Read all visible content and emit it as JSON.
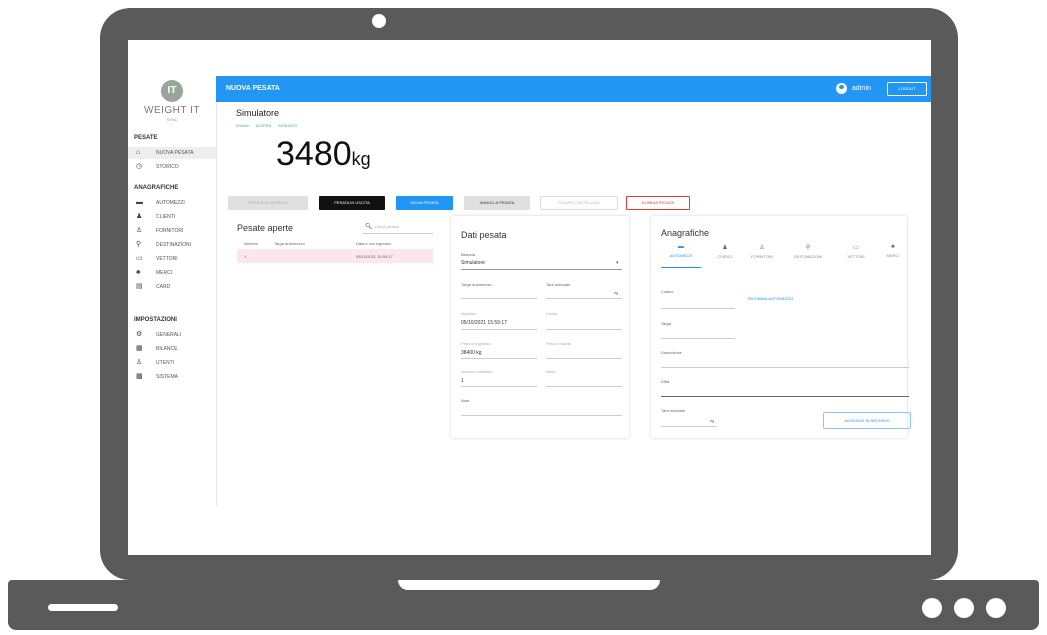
{
  "topbar": {
    "title": "NUOVA PESATA",
    "user": "admin",
    "logout": "LOGOUT"
  },
  "brand": {
    "logo_mark": "IT",
    "logo_text": "WEIGHT IT",
    "logo_sub": "SYNC"
  },
  "sidebar": {
    "sections": [
      {
        "title": "PESATE",
        "items": [
          {
            "label": "NUOVA PESATA",
            "icon": "home-icon",
            "glyph": "⌂",
            "active": true
          },
          {
            "label": "STORICO",
            "icon": "history-icon",
            "glyph": "◷"
          }
        ]
      },
      {
        "title": "ANAGRAFICHE",
        "items": [
          {
            "label": "AUTOMEZZI",
            "icon": "truck-icon",
            "glyph": "▬"
          },
          {
            "label": "CLIENTI",
            "icon": "person-icon",
            "glyph": "♟"
          },
          {
            "label": "FORNITORI",
            "icon": "supplier-icon",
            "glyph": "♙"
          },
          {
            "label": "DESTINAZIONI",
            "icon": "location-pin-icon",
            "glyph": "⚲"
          },
          {
            "label": "VETTORI",
            "icon": "carrier-icon",
            "glyph": "▭"
          },
          {
            "label": "MERCI",
            "icon": "goods-icon",
            "glyph": "♣"
          },
          {
            "label": "CARD",
            "icon": "card-icon",
            "glyph": "▤"
          }
        ]
      },
      {
        "title": "IMPOSTAZIONI",
        "items": [
          {
            "label": "GENERALI",
            "icon": "gear-icon",
            "glyph": "⚙"
          },
          {
            "label": "BILANCE",
            "icon": "scale-icon",
            "glyph": "▦"
          },
          {
            "label": "UTENTI",
            "icon": "users-icon",
            "glyph": "♙"
          },
          {
            "label": "SISTEMA",
            "icon": "system-icon",
            "glyph": "▩"
          }
        ]
      }
    ]
  },
  "scale": {
    "name": "Simulatore",
    "links": [
      "Priorità",
      "AZZERA",
      "ASSUNTO"
    ],
    "weight": "3480",
    "unit": "kg"
  },
  "actions": {
    "weigh_in": "PESATA IN ENTRATA",
    "weigh_out": "PESATA IN USCITA",
    "save": "SALVA PESATA",
    "cancel": "ANNULLA PESATA",
    "print": "STAMPA CARTELLINO",
    "delete": "ELIMINA PESATA"
  },
  "open_weighings": {
    "title": "Pesate aperte",
    "search_placeholder": "Cerca pesata",
    "columns": [
      "Numero",
      "Targa automezzo",
      "Data e ora ingresso"
    ],
    "rows": [
      {
        "numero": "1",
        "targa": "",
        "data": "05/10/2021 15:59:17"
      }
    ]
  },
  "details": {
    "title": "Dati pesata",
    "scale_label": "Bilancia",
    "scale_value": "Simulatore",
    "plate_label": "Targa automezzo",
    "tare_label": "Tara manuale",
    "tare_unit": "kg",
    "entry_label": "Ingresso",
    "entry_value": "05/10/2021 15:59:17",
    "exit_label": "Uscita",
    "weight_in_label": "Peso in ingresso",
    "weight_in_value": "38400 kg",
    "weight_out_label": "Peso in uscita",
    "card_label": "Numero cartellino",
    "card_value": "1",
    "net_label": "Netto",
    "notes_label": "Note"
  },
  "registry": {
    "title": "Anagrafiche",
    "tabs": [
      {
        "label": "AUTOMEZZI",
        "icon": "truck-icon",
        "glyph": "▬",
        "active": true
      },
      {
        "label": "CLIENTI",
        "icon": "person-icon",
        "glyph": "♟"
      },
      {
        "label": "FORNITORI",
        "icon": "supplier-icon",
        "glyph": "♙"
      },
      {
        "label": "DESTINAZIONI",
        "icon": "location-pin-icon",
        "glyph": "⚲"
      },
      {
        "label": "VETTORI",
        "icon": "carrier-icon",
        "glyph": "▭"
      },
      {
        "label": "MERCI",
        "icon": "goods-icon",
        "glyph": "♣"
      }
    ],
    "code_label": "Codice",
    "recall_button": "RICHIAMA AUTOMEZZO",
    "plate_label": "Targa",
    "description_label": "Descrizione",
    "company_label": "Ditta",
    "tare_label": "Tara manuale",
    "tare_unit": "kg",
    "add_button": "AGGIUNGI IN ARCHIVIO"
  },
  "colors": {
    "primary": "#2196f3",
    "danger": "#e53935",
    "row_highlight": "#fde7ea",
    "laptop": "#5a5a5a"
  }
}
